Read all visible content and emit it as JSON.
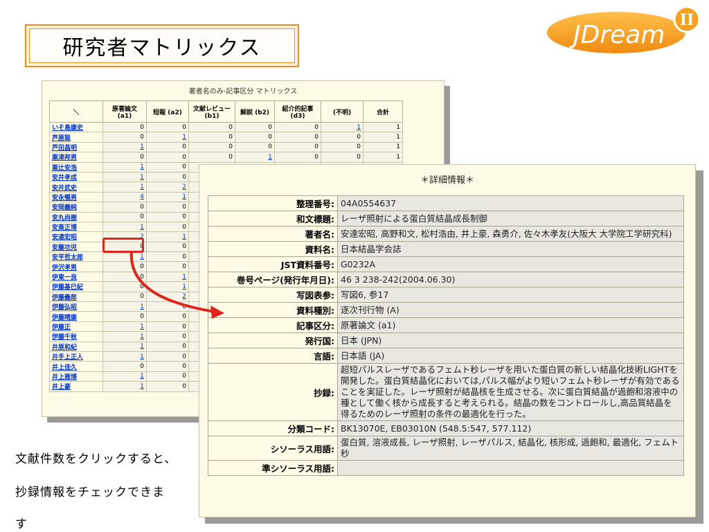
{
  "title": "研究者マトリックス",
  "logo": {
    "text": "JDream",
    "numeral": "II",
    "colors": {
      "brand": "#f5a11d",
      "text": "#ffffff"
    }
  },
  "matrix": {
    "title": "著者名のみ-記事区分 マトリックス",
    "columns": [
      "＼",
      "原著論文\n(a1)",
      "短報 (a2)",
      "文献レビュー\n(b1)",
      "解説 (b2)",
      "紹介的記事\n(d3)",
      "(不明)",
      "合計"
    ],
    "rows": [
      {
        "name": "いそ島康史",
        "cells": [
          "0",
          "0",
          "0",
          "0",
          "0",
          "1",
          "1"
        ],
        "links": [
          5
        ]
      },
      {
        "name": "芦原聡",
        "cells": [
          "0",
          "1",
          "0",
          "0",
          "0",
          "0",
          "1"
        ],
        "links": [
          1
        ]
      },
      {
        "name": "芦田昌明",
        "cells": [
          "1",
          "0",
          "0",
          "0",
          "0",
          "0",
          "1"
        ],
        "links": [
          0
        ]
      },
      {
        "name": "粟津邦男",
        "cells": [
          "0",
          "0",
          "0",
          "1",
          "0",
          "0",
          "1"
        ],
        "links": [
          3
        ]
      },
      {
        "name": "粟辻安浩",
        "cells": [
          "1",
          "0"
        ],
        "links": [
          0
        ]
      },
      {
        "name": "安井孝成",
        "cells": [
          "1",
          "0"
        ],
        "links": [
          0
        ]
      },
      {
        "name": "安井武史",
        "cells": [
          "1",
          "2"
        ],
        "links": [
          0,
          1
        ]
      },
      {
        "name": "安永暢男",
        "cells": [
          "4",
          "1"
        ],
        "links": [
          0,
          1
        ]
      },
      {
        "name": "安岡義純",
        "cells": [
          "0",
          "0"
        ],
        "links": []
      },
      {
        "name": "安丸尚樹",
        "cells": [
          "0",
          "0"
        ],
        "links": []
      },
      {
        "name": "安斎正博",
        "cells": [
          "1",
          "0"
        ],
        "links": [
          0
        ]
      },
      {
        "name": "安達宏昭",
        "cells": [
          "2",
          "1"
        ],
        "links": [
          0,
          1
        ]
      },
      {
        "name": "安藤功児",
        "cells": [
          "0",
          "0"
        ],
        "links": []
      },
      {
        "name": "安平哲太郎",
        "cells": [
          "1",
          "0"
        ],
        "links": [
          0
        ]
      },
      {
        "name": "伊沢孝男",
        "cells": [
          "0",
          "0"
        ],
        "links": []
      },
      {
        "name": "伊東一良",
        "cells": [
          "0",
          "1"
        ],
        "links": [
          1
        ]
      },
      {
        "name": "伊藤基巳紀",
        "cells": [
          "0",
          "1"
        ],
        "links": [
          1
        ]
      },
      {
        "name": "伊藤義郎",
        "cells": [
          "0",
          "2"
        ],
        "links": [
          1
        ]
      },
      {
        "name": "伊藤弘昭",
        "cells": [
          "1",
          "0"
        ],
        "links": [
          0
        ]
      },
      {
        "name": "伊藤晴康",
        "cells": [
          "0",
          "0"
        ],
        "links": []
      },
      {
        "name": "伊藤正",
        "cells": [
          "1",
          "0"
        ],
        "links": [
          0
        ]
      },
      {
        "name": "伊藤千秋",
        "cells": [
          "1",
          "0"
        ],
        "links": [
          0
        ]
      },
      {
        "name": "井原和紀",
        "cells": [
          "1",
          "0"
        ],
        "links": [
          0
        ]
      },
      {
        "name": "井手上正人",
        "cells": [
          "1",
          "0"
        ],
        "links": [
          0
        ]
      },
      {
        "name": "井上佳久",
        "cells": [
          "0",
          "0"
        ],
        "links": []
      },
      {
        "name": "井上雅博",
        "cells": [
          "1",
          "0"
        ],
        "links": [
          0
        ]
      },
      {
        "name": "井上豪",
        "cells": [
          "1",
          "0"
        ],
        "links": [
          0
        ]
      }
    ]
  },
  "detail": {
    "title": "＊詳細情報＊",
    "fields": [
      {
        "label": "整理番号:",
        "value": "04A0554637"
      },
      {
        "label": "和文標題:",
        "value": "レーザ照射による蛋白質結晶成長制御"
      },
      {
        "label": "著者名:",
        "value": "安達宏昭, 高野和文, 松村浩由, 井上豪, 森勇介, 佐々木孝友(大阪大 大学院工学研究科)"
      },
      {
        "label": "資料名:",
        "value": "日本結晶学会誌"
      },
      {
        "label": "JST資料番号:",
        "value": "G0232A"
      },
      {
        "label": "巻号ページ(発行年月日):",
        "value": "46 3 238-242(2004.06.30)"
      },
      {
        "label": "写図表参:",
        "value": "写図6, 参17"
      },
      {
        "label": "資料種別:",
        "value": "逐次刊行物 (A)"
      },
      {
        "label": "記事区分:",
        "value": "原著論文 (a1)"
      },
      {
        "label": "発行国:",
        "value": "日本 (JPN)"
      },
      {
        "label": "言語:",
        "value": "日本語 (JA)"
      },
      {
        "label": "抄録:",
        "value": "超短パルスレーザであるフェムト秒レーザを用いた蛋白質の新しい結晶化技術LIGHTを開発した。蛋白質結晶化においては,パルス幅がより短いフェムト秒レーザが有効であることを実証した。レーザ照射が結晶核を生成させる。次に蛋白質結晶が過飽和溶液中の種として働く核から成長すると考えられる。結晶の数をコントロールし,高品質結晶を得るためのレーザ照射の条件の最適化を行った。"
      },
      {
        "label": "分類コード:",
        "value": "BK13070E, EB03010N (548.5:547, 577.112)"
      },
      {
        "label": "シソーラス用語:",
        "value": "蛋白質, 溶液成長, レーザ照射, レーザパルス, 結晶化, 核形成, 過飽和, 最適化, フェムト秒"
      },
      {
        "label": "準シソーラス用語:",
        "value": ""
      }
    ]
  },
  "caption": [
    "文献件数をクリックすると、",
    "抄録情報をチェックできま",
    "す"
  ],
  "colors": {
    "accent": "#f08c1e",
    "highlight": "#e0241c",
    "link": "#0033cc"
  }
}
